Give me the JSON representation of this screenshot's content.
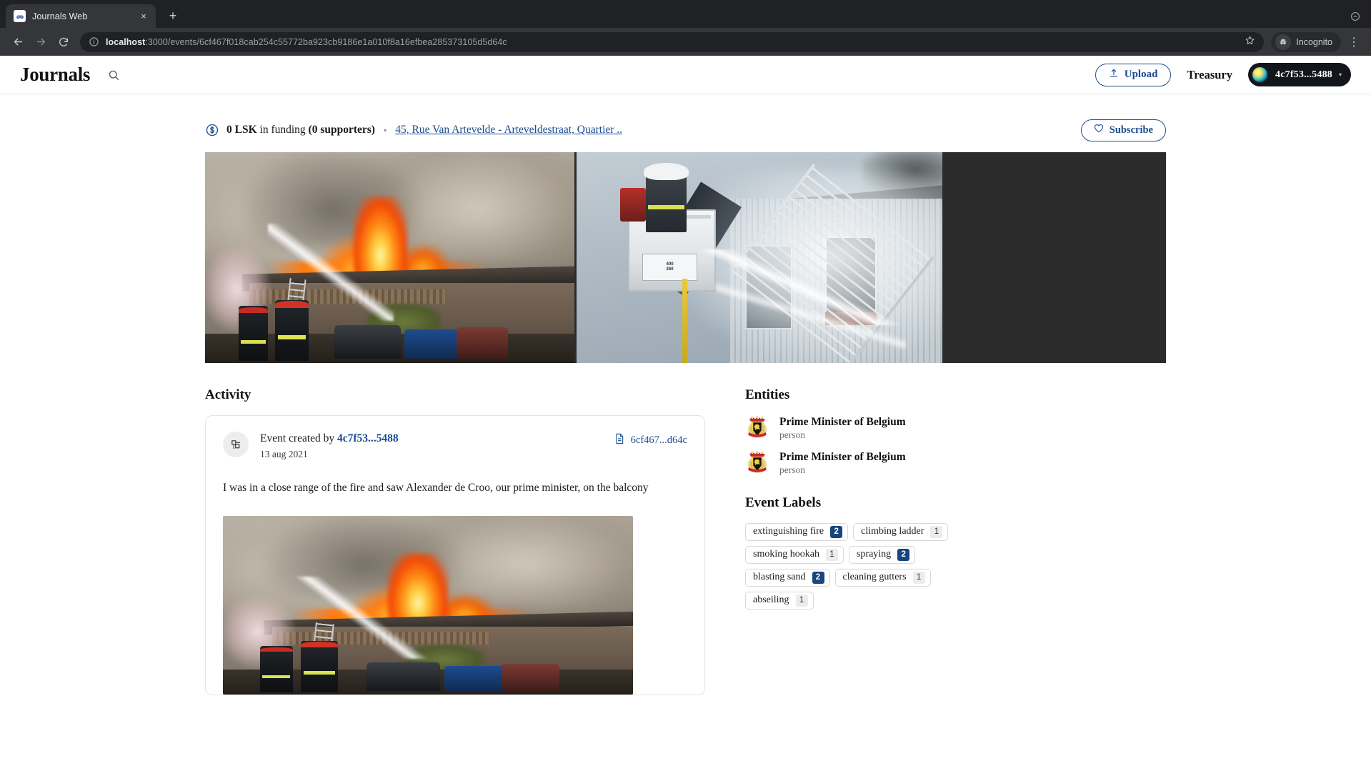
{
  "browser": {
    "tab": {
      "title": "Journals Web",
      "favicon": "game-controller-icon",
      "close": "×"
    },
    "new_tab": "+",
    "nav": {
      "back": "←",
      "forward": "→",
      "reload": "⟳"
    },
    "url_host": "localhost",
    "url_rest": ":3000/events/6cf467f018cab254c55772ba923cb9186e1a010f8a16efbea285373105d5d64c",
    "incognito_label": "Incognito",
    "menu": "⋮"
  },
  "header": {
    "brand": "Journals",
    "search_icon": "search-icon",
    "upload_label": "Upload",
    "treasury_label": "Treasury",
    "account_name": "4c7f53...5488",
    "account_caret": "▾"
  },
  "funding": {
    "amount": "0 LSK",
    "in_funding": " in funding ",
    "supporters": "(0 supporters)",
    "separator": "▪",
    "address": "45, Rue Van Artevelde - Arteveldestraat, Quartier ..",
    "subscribe_label": "Subscribe"
  },
  "activity": {
    "section_title": "Activity",
    "created_prefix": "Event created by ",
    "created_by": "4c7f53...5488",
    "date": "13 aug 2021",
    "doc_ref": "6cf467...d64c",
    "body": "I was in a close range of the fire and saw Alexander de Croo, our prime minister, on the balcony"
  },
  "entities": {
    "section_title": "Entities",
    "items": [
      {
        "name": "Prime Minister of Belgium",
        "type": "person"
      },
      {
        "name": "Prime Minister of Belgium",
        "type": "person"
      }
    ]
  },
  "event_labels": {
    "section_title": "Event Labels",
    "items": [
      {
        "label": "extinguishing fire",
        "count": "2",
        "highlight": true
      },
      {
        "label": "climbing ladder",
        "count": "1",
        "highlight": false
      },
      {
        "label": "smoking hookah",
        "count": "1",
        "highlight": false
      },
      {
        "label": "spraying",
        "count": "2",
        "highlight": true
      },
      {
        "label": "blasting sand",
        "count": "2",
        "highlight": true
      },
      {
        "label": "cleaning gutters",
        "count": "1",
        "highlight": false
      },
      {
        "label": "abseiling",
        "count": "1",
        "highlight": false
      }
    ]
  },
  "media": {
    "photo_1_alt": "burning-building-firefighters-photo",
    "photo_2_alt": "aerial-ladder-platform-photo"
  },
  "colors": {
    "accent_blue": "#1a4d8f",
    "badge_blue": "#17457e",
    "chrome_dark": "#35363a",
    "banner_bg": "#2b2b2b"
  }
}
